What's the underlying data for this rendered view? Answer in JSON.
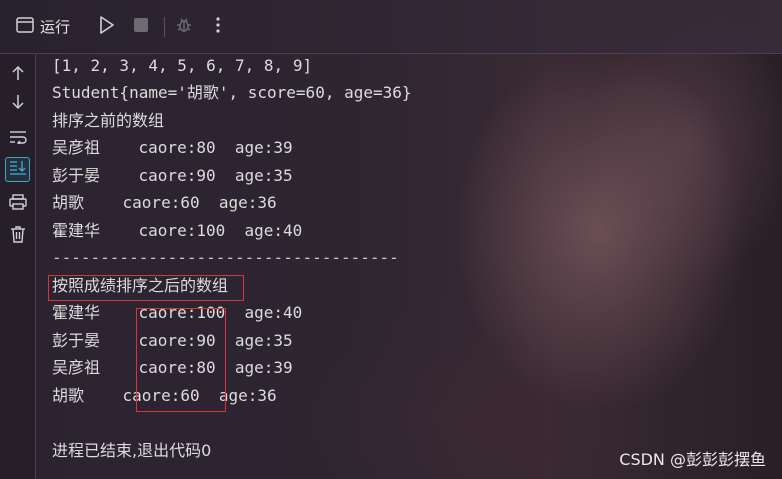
{
  "toolbar": {
    "run_label": "运行",
    "icons": [
      "console-window-icon",
      "run-icon",
      "stop-icon",
      "debug-icon",
      "more-icon"
    ]
  },
  "sidebar": {
    "icons": [
      "arrow-up-icon",
      "arrow-down-icon",
      "soft-wrap-icon",
      "scroll-to-end-icon",
      "print-icon",
      "trash-icon"
    ]
  },
  "console": {
    "lines": [
      "[1, 2, 3, 4, 5, 6, 7, 8, 9]",
      "Student{name='胡歌', score=60, age=36}",
      "排序之前的数组",
      "吴彦祖    caore:80  age:39",
      "彭于晏    caore:90  age:35",
      "胡歌    caore:60  age:36",
      "霍建华    caore:100  age:40",
      "------------------------------------",
      "按照成绩排序之后的数组",
      "霍建华    caore:100  age:40",
      "彭于晏    caore:90  age:35",
      "吴彦祖    caore:80  age:39",
      "胡歌    caore:60  age:36",
      "",
      "进程已结束,退出代码0"
    ]
  },
  "watermark": "CSDN @彭彭彭摆鱼",
  "colors": {
    "highlight_box": "#d9343a",
    "active_icon_border": "#3aa6c9",
    "text": "#dcdcdc"
  }
}
